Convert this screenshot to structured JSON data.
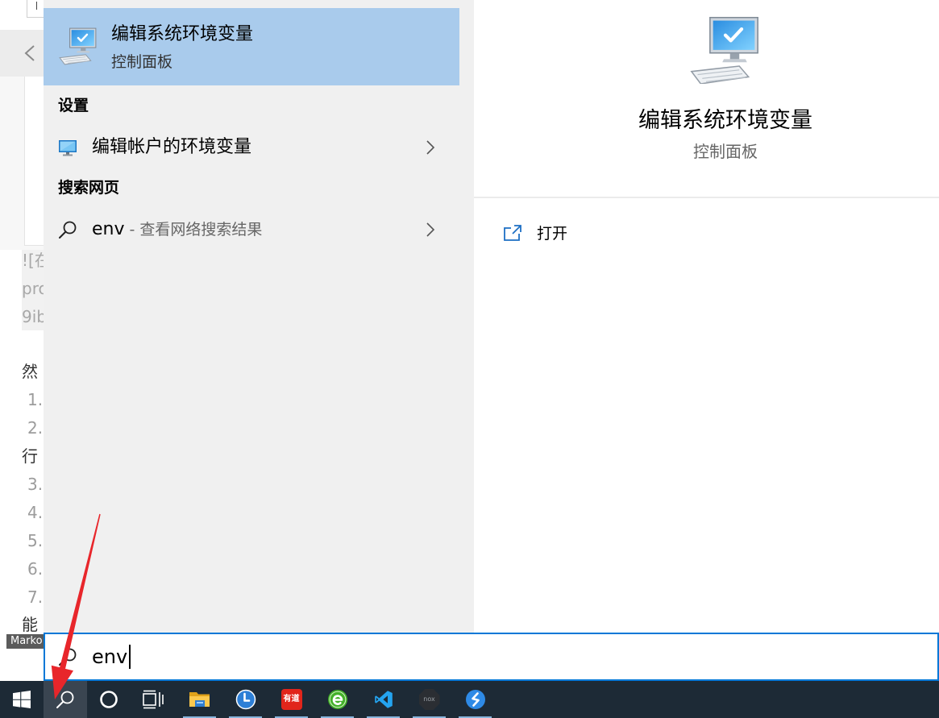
{
  "colors": {
    "accent": "#0078d7",
    "highlight": "#a9cbec",
    "panel": "#f0f0f0",
    "taskbar": "#1d2a36",
    "taskbar_active": "#3a4551",
    "running_indicator": "#87b4dc",
    "annotation_arrow": "#e8262b"
  },
  "background_page": {
    "lines": [
      "![在",
      "pro",
      "9ib",
      "然",
      "1.",
      "2.",
      "行",
      "3.",
      "4.",
      "5.",
      "6.",
      "7.",
      "能"
    ],
    "editor_label": "Marko"
  },
  "search": {
    "best_match": {
      "title": "编辑系统环境变量",
      "subtitle": "控制面板",
      "icon": "system-environment-icon"
    },
    "sections": [
      {
        "heading": "设置",
        "items": [
          {
            "label": "编辑帐户的环境变量",
            "icon": "monitor-icon"
          }
        ]
      },
      {
        "heading": "搜索网页",
        "items": [
          {
            "label": "env",
            "suffix": " - 查看网络搜索结果",
            "icon": "search-icon"
          }
        ]
      }
    ],
    "preview": {
      "title": "编辑系统环境变量",
      "subtitle": "控制面板",
      "icon": "system-environment-icon",
      "actions": [
        {
          "label": "打开",
          "icon": "open-icon"
        }
      ]
    },
    "query": "env"
  },
  "taskbar": {
    "items": [
      {
        "icon": "windows-logo-icon"
      },
      {
        "icon": "search-icon",
        "active": true
      },
      {
        "icon": "cortana-icon"
      },
      {
        "icon": "task-view-icon"
      },
      {
        "icon": "folder-icon",
        "running": true
      },
      {
        "icon": "clock-icon",
        "running": true
      },
      {
        "icon": "youdao-icon",
        "running": true
      },
      {
        "icon": "browser-e-icon",
        "running": true
      },
      {
        "icon": "vscode-icon",
        "running": true
      },
      {
        "icon": "nox-icon",
        "running": true
      },
      {
        "icon": "blue-s-app-icon",
        "running": true
      }
    ],
    "youdao_logo_text": "有道",
    "nox_logo_text": "nox"
  }
}
